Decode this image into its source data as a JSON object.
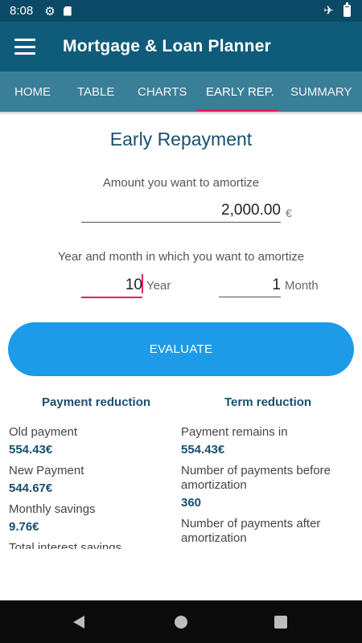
{
  "status": {
    "time": "8:08"
  },
  "app": {
    "title": "Mortgage & Loan Planner"
  },
  "tabs": [
    {
      "label": "HOME"
    },
    {
      "label": "TABLE"
    },
    {
      "label": "CHARTS"
    },
    {
      "label": "EARLY REP."
    },
    {
      "label": "SUMMARY"
    }
  ],
  "form": {
    "title": "Early Repayment",
    "amount_label": "Amount you want to amortize",
    "amount_value": "2,000.00",
    "currency": "€",
    "date_label": "Year and month in which you want to amortize",
    "year_value": "10",
    "year_label": "Year",
    "month_value": "1",
    "month_label": "Month",
    "evaluate_label": "EVALUATE"
  },
  "payment_reduction": {
    "heading": "Payment reduction",
    "old_label": "Old payment",
    "old_value": "554.43€",
    "new_label": "New Payment",
    "new_value": "544.67€",
    "savings_label": "Monthly savings",
    "savings_value": "9.76€",
    "interest_label": "Total interest savings"
  },
  "term_reduction": {
    "heading": "Term reduction",
    "remains_label": "Payment remains in",
    "remains_value": "554.43€",
    "before_label": "Number of payments before amortization",
    "before_value": "360",
    "after_label": "Number of payments after amortization"
  },
  "colors": {
    "appbar": "#0f5c7a",
    "tabs": "#3a7f98",
    "accent": "#e91e63",
    "button": "#1e9be8",
    "value_text": "#184f70"
  }
}
